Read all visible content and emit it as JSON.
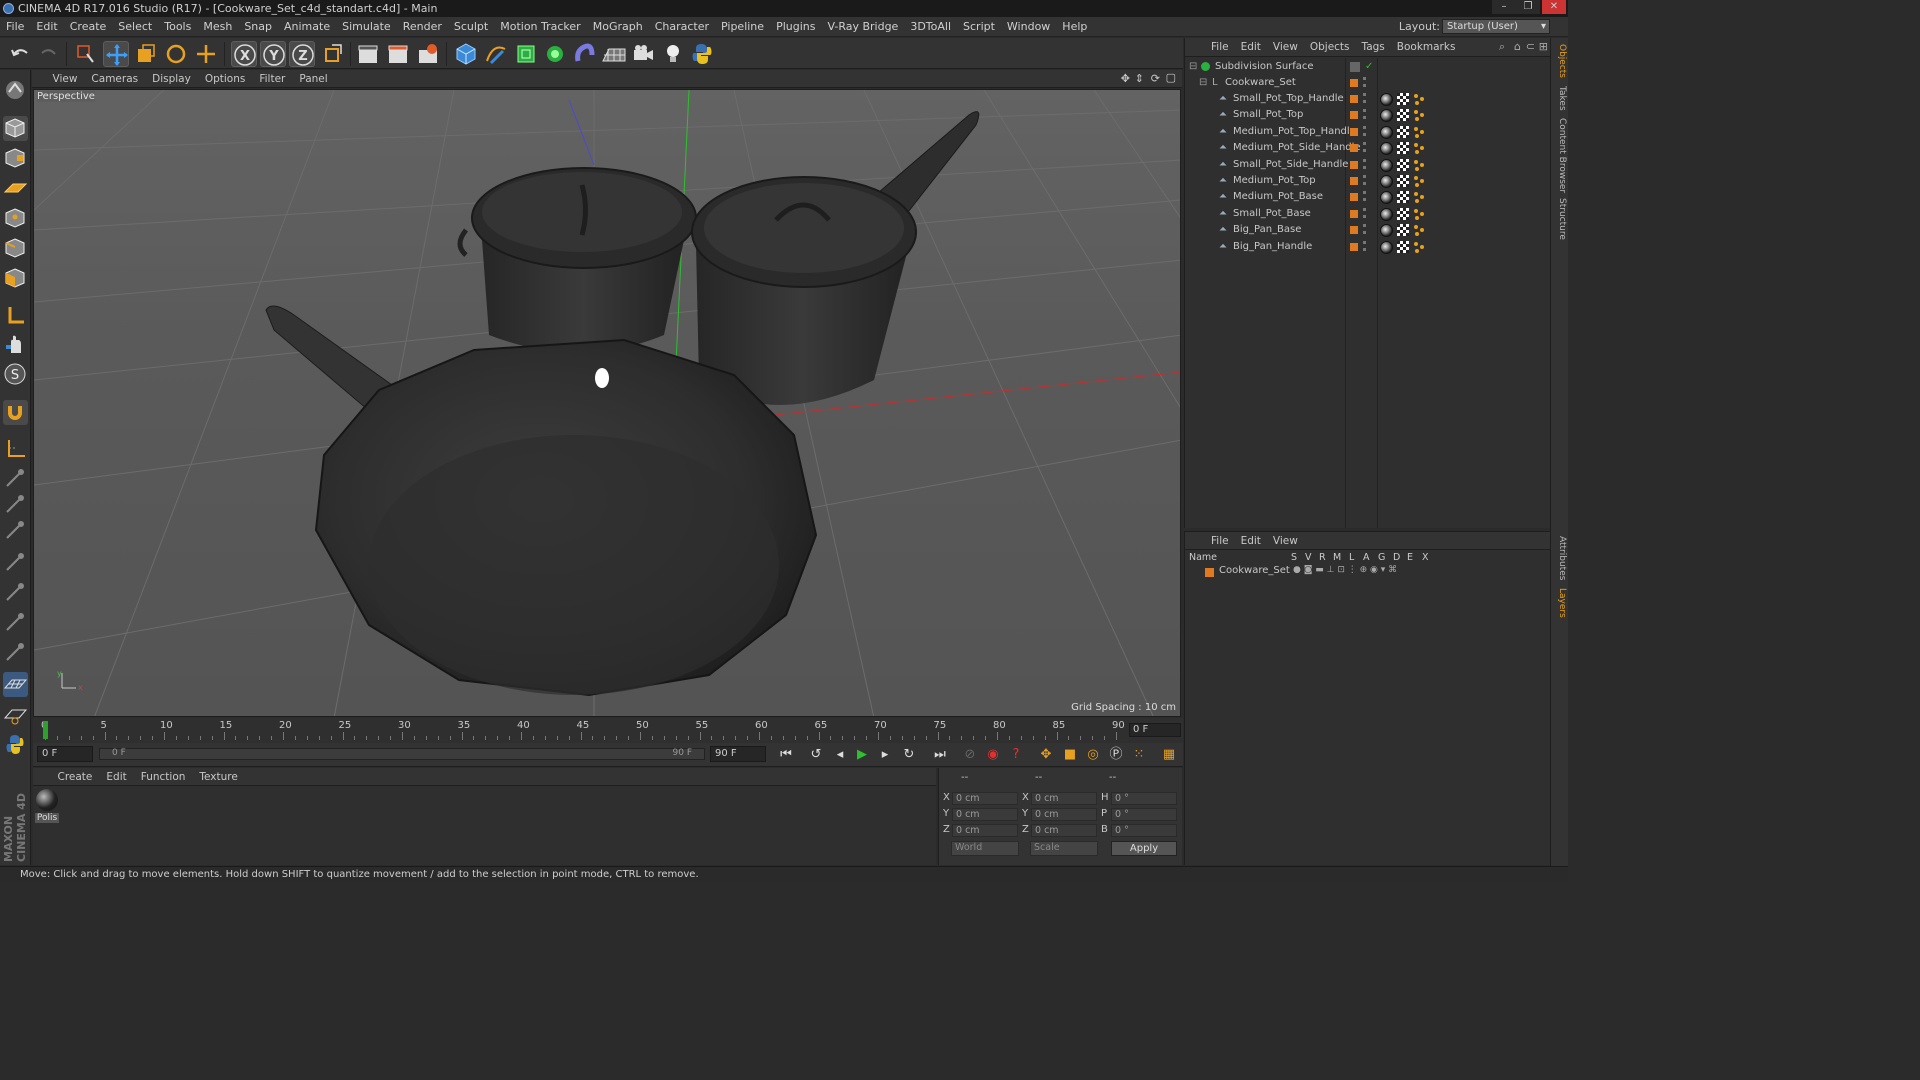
{
  "window": {
    "title": "CINEMA 4D R17.016 Studio (R17) - [Cookware_Set_c4d_standart.c4d] - Main",
    "controls": [
      "–",
      "❐",
      "✕"
    ]
  },
  "menubar": {
    "items": [
      "File",
      "Edit",
      "Create",
      "Select",
      "Tools",
      "Mesh",
      "Snap",
      "Animate",
      "Simulate",
      "Render",
      "Sculpt",
      "Motion Tracker",
      "MoGraph",
      "Character",
      "Pipeline",
      "Plugins",
      "V-Ray Bridge",
      "3DToAll",
      "Script",
      "Window",
      "Help"
    ],
    "layout_label": "Layout:",
    "layout_value": "Startup (User)"
  },
  "toolbar": {
    "axis_x": "X",
    "axis_y": "Y",
    "axis_z": "Z"
  },
  "viewport": {
    "menu": [
      "View",
      "Cameras",
      "Display",
      "Options",
      "Filter",
      "Panel"
    ],
    "camera_label": "Perspective",
    "grid_spacing": "Grid Spacing : 10 cm",
    "axis_y_label": "y",
    "axis_x_label": "x"
  },
  "timeline": {
    "marks": [
      "0",
      "5",
      "10",
      "15",
      "20",
      "25",
      "30",
      "35",
      "40",
      "45",
      "50",
      "55",
      "60",
      "65",
      "70",
      "75",
      "80",
      "85",
      "90"
    ],
    "current_frame": "0 F"
  },
  "transport": {
    "start_field": "0 F",
    "range_start": "0 F",
    "range_end": "90 F",
    "end_field": "90 F"
  },
  "material_manager": {
    "menu": [
      "Create",
      "Edit",
      "Function",
      "Texture"
    ],
    "materials": [
      {
        "name": "Polis"
      }
    ]
  },
  "coordinates": {
    "headers": [
      "--",
      "--",
      "--"
    ],
    "rows": [
      {
        "pos_label": "X",
        "pos": "0 cm",
        "size_label": "X",
        "size": "0 cm",
        "rot_label": "H",
        "rot": "0 °"
      },
      {
        "pos_label": "Y",
        "pos": "0 cm",
        "size_label": "Y",
        "size": "0 cm",
        "rot_label": "P",
        "rot": "0 °"
      },
      {
        "pos_label": "Z",
        "pos": "0 cm",
        "size_label": "Z",
        "size": "0 cm",
        "rot_label": "B",
        "rot": "0 °"
      }
    ],
    "mode_select": "World",
    "scale_select": "Scale",
    "apply_label": "Apply"
  },
  "object_manager": {
    "menu": [
      "File",
      "Edit",
      "View",
      "Objects",
      "Tags",
      "Bookmarks"
    ],
    "root": "Subdivision Surface",
    "group": "Cookware_Set",
    "objects": [
      "Small_Pot_Top_Handle",
      "Small_Pot_Top",
      "Medium_Pot_Top_Handle",
      "Medium_Pot_Side_Handle",
      "Small_Pot_Side_Handle",
      "Medium_Pot_Top",
      "Medium_Pot_Base",
      "Small_Pot_Base",
      "Big_Pan_Base",
      "Big_Pan_Handle"
    ]
  },
  "layer_manager": {
    "menu": [
      "File",
      "Edit",
      "View"
    ],
    "columns": [
      "Name",
      "S",
      "V",
      "R",
      "M",
      "L",
      "A",
      "G",
      "D",
      "E",
      "X"
    ],
    "layers": [
      "Cookware_Set"
    ]
  },
  "right_tabs": [
    "Objects",
    "Takes",
    "Content Browser",
    "Structure",
    "Attributes",
    "Layers"
  ],
  "brand": "MAXON CINEMA 4D",
  "status": "Move: Click and drag to move elements. Hold down SHIFT to quantize movement / add to the selection in point mode, CTRL to remove.",
  "colors": {
    "accent_orange": "#e07a20",
    "axis_red": "#c03030",
    "axis_green": "#30c030",
    "axis_blue": "#4040c0"
  }
}
